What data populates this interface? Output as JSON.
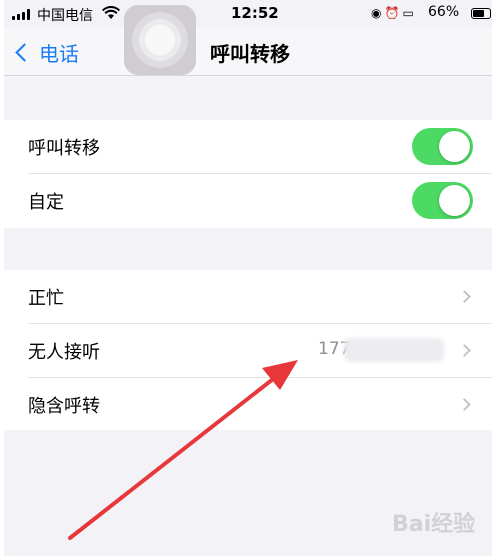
{
  "status_bar": {
    "carrier": "中国电信",
    "time": "12:52",
    "battery_percent": "66%"
  },
  "nav": {
    "back_label": "电话",
    "title": "呼叫转移"
  },
  "group1": {
    "rows": [
      {
        "label": "呼叫转移",
        "toggle_on": true
      },
      {
        "label": "自定",
        "toggle_on": true
      }
    ]
  },
  "group2": {
    "rows": [
      {
        "label": "正忙",
        "value": ""
      },
      {
        "label": "无人接听",
        "value": "177"
      },
      {
        "label": "隐含呼转",
        "value": ""
      }
    ]
  },
  "watermark": "Bai经验",
  "colors": {
    "accent_blue": "#1a7cf5",
    "toggle_green": "#4cd964",
    "annotation_red": "#e8373a"
  }
}
